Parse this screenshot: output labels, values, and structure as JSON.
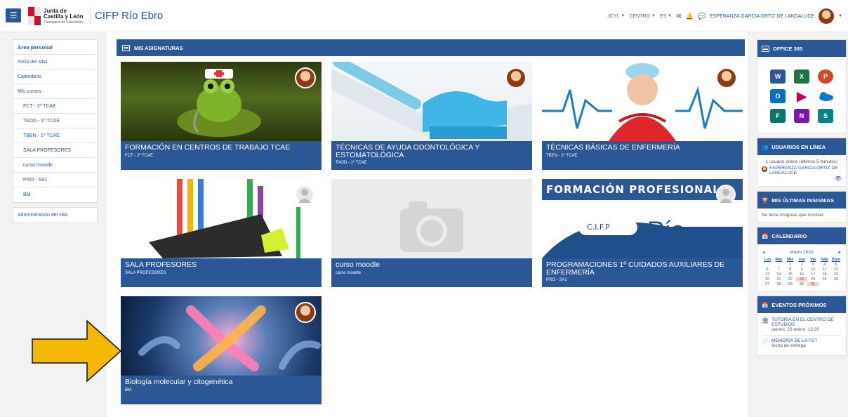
{
  "navbar": {
    "logo": {
      "line1": "Junta de",
      "line2": "Castilla y León",
      "line3": "Consejería de Educación"
    },
    "site_name": "CIFP Río Ebro",
    "menus": [
      "JCYL",
      "CENTRO",
      "ES"
    ],
    "user_name": "ESPERANZA GARCIA ORTIZ DE LANDALUCE"
  },
  "sidebar": {
    "items": [
      {
        "label": "Área personal"
      },
      {
        "label": "Inicio del sitio"
      },
      {
        "label": "Calendario"
      },
      {
        "label": "Mis cursos"
      },
      {
        "label": "FCT - 2º TCAE"
      },
      {
        "label": "TAOD - 1º TCAE"
      },
      {
        "label": "TBEN - 1º TCAE"
      },
      {
        "label": "SALA PROFESORES"
      },
      {
        "label": "curso moodle"
      },
      {
        "label": "PRO - SA1"
      },
      {
        "label": "BM"
      }
    ],
    "admin_label": "Administración del sitio"
  },
  "main": {
    "header": "MIS ASIGNATURAS",
    "courses": [
      {
        "title": "FORMACIÓN EN CENTROS DE TRABAJO TCAE",
        "short": "FCT - 2º TCAE"
      },
      {
        "title": "TÉCNICAS DE AYUDA ODONTOLÓGICA Y ESTOMATOLÓGICA",
        "short": "TAOD - 1º TCAE"
      },
      {
        "title": "TÉCNICAS BÁSICAS DE ENFERMERÍA",
        "short": "TBEN - 1º TCAE"
      },
      {
        "title": "SALA PROFESORES",
        "short": "SALA PROFESORES"
      },
      {
        "title": "curso moodle",
        "short": "curso moodle"
      },
      {
        "title": "PROGRAMACIONES 1º CUIDADOS AUXILIARES DE ENFERMERÍA",
        "short": "PRO - SA1",
        "banner": "FORMACIÓN PROFESIONAL",
        "logo_text": "C.I.F.P",
        "logo_word": "Río"
      },
      {
        "title": "Biología molecular y citogenética",
        "short": "BM"
      }
    ]
  },
  "right": {
    "office": {
      "header": "OFFICE 365"
    },
    "users_online": {
      "header": "USUARIOS EN LÍNEA",
      "summary": "1 usuario online (últimos 5 minutos)",
      "user": "ESPERANZA GARCIA ORTIZ DE LANDALUCE"
    },
    "badges": {
      "header": "MIS ÚLTIMAS INSIGNIAS",
      "text": "No tiene insignias que mostrar"
    },
    "calendar": {
      "header": "CALENDARIO",
      "month": "enero 2020",
      "prev": "◄",
      "next": "►",
      "day_headers": [
        "Lun",
        "Mar",
        "Mié",
        "Jue",
        "Vie",
        "Sáb",
        "Dom"
      ],
      "cells": [
        "",
        "",
        "1",
        "2",
        "3",
        "4",
        "5",
        "6",
        "7",
        "8",
        "9",
        "10",
        "11",
        "12",
        "13",
        "14",
        "15",
        "16",
        "17",
        "18",
        "19",
        "20",
        "21",
        "22",
        "23",
        "24",
        "25",
        "26",
        "27",
        "28",
        "29",
        "30",
        "31",
        "",
        ""
      ]
    },
    "events": {
      "header": "EVENTOS PRÓXIMOS",
      "items": [
        {
          "title": "TUTORÍA EN EL CENTRO DE ESTUDIOS",
          "when": "jueves, 23 enero, 12:20"
        },
        {
          "title": "MEMORIA DE LA FCT",
          "when": "fecha de entrega"
        }
      ]
    }
  },
  "colors": {
    "brand": "#2b5797",
    "arrow": "#f5b800",
    "highlight": "#f7d0c4"
  }
}
